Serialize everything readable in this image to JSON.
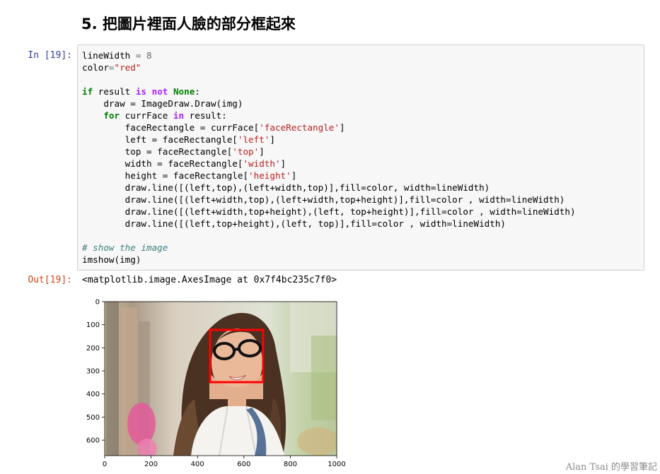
{
  "heading": "5. 把圖片裡面人臉的部分框起來",
  "cell": {
    "in_prompt": "In [19]:",
    "out_prompt": "Out[19]:",
    "output_text": "<matplotlib.image.AxesImage at 0x7f4bc235c7f0>"
  },
  "code": {
    "l1_var": "lineWidth",
    "l1_op": " = ",
    "l1_num": "8",
    "l2_var": "color",
    "l2_op": "=",
    "l2_str": "\"red\"",
    "l4_kw": "if",
    "l4_a": " result ",
    "l4_is": "is",
    "l4_sp": " ",
    "l4_not": "not",
    "l4_b": " ",
    "l4_none": "None",
    "l4_c": ":",
    "l5": "    draw = ImageDraw.Draw(img)",
    "l6_indent": "    ",
    "l6_for": "for",
    "l6_a": " currFace ",
    "l6_in": "in",
    "l6_b": " result:",
    "l7_a": "        faceRectangle = currFace[",
    "l7_s": "'faceRectangle'",
    "l7_b": "]",
    "l8_a": "        left = faceRectangle[",
    "l8_s": "'left'",
    "l8_b": "]",
    "l9_a": "        top = faceRectangle[",
    "l9_s": "'top'",
    "l9_b": "]",
    "l10_a": "        width = faceRectangle[",
    "l10_s": "'width'",
    "l10_b": "]",
    "l11_a": "        height = faceRectangle[",
    "l11_s": "'height'",
    "l11_b": "]",
    "l12": "        draw.line([(left,top),(left+width,top)],fill=color, width=lineWidth)",
    "l13": "        draw.line([(left+width,top),(left+width,top+height)],fill=color , width=lineWidth)",
    "l14": "        draw.line([(left+width,top+height),(left, top+height)],fill=color , width=lineWidth)",
    "l15": "        draw.line([(left,top+height),(left, top)],fill=color , width=lineWidth)",
    "l17": "# show the image",
    "l18": "imshow(img)"
  },
  "plot": {
    "x_ticks": [
      "0",
      "200",
      "400",
      "600",
      "800",
      "1000"
    ],
    "y_ticks": [
      "0",
      "100",
      "200",
      "300",
      "400",
      "500",
      "600"
    ],
    "image_description_icon": "photo-of-woman-with-glasses",
    "face_box_color": "#ff0000"
  },
  "watermark": "Alan Tsai 的學習筆記"
}
